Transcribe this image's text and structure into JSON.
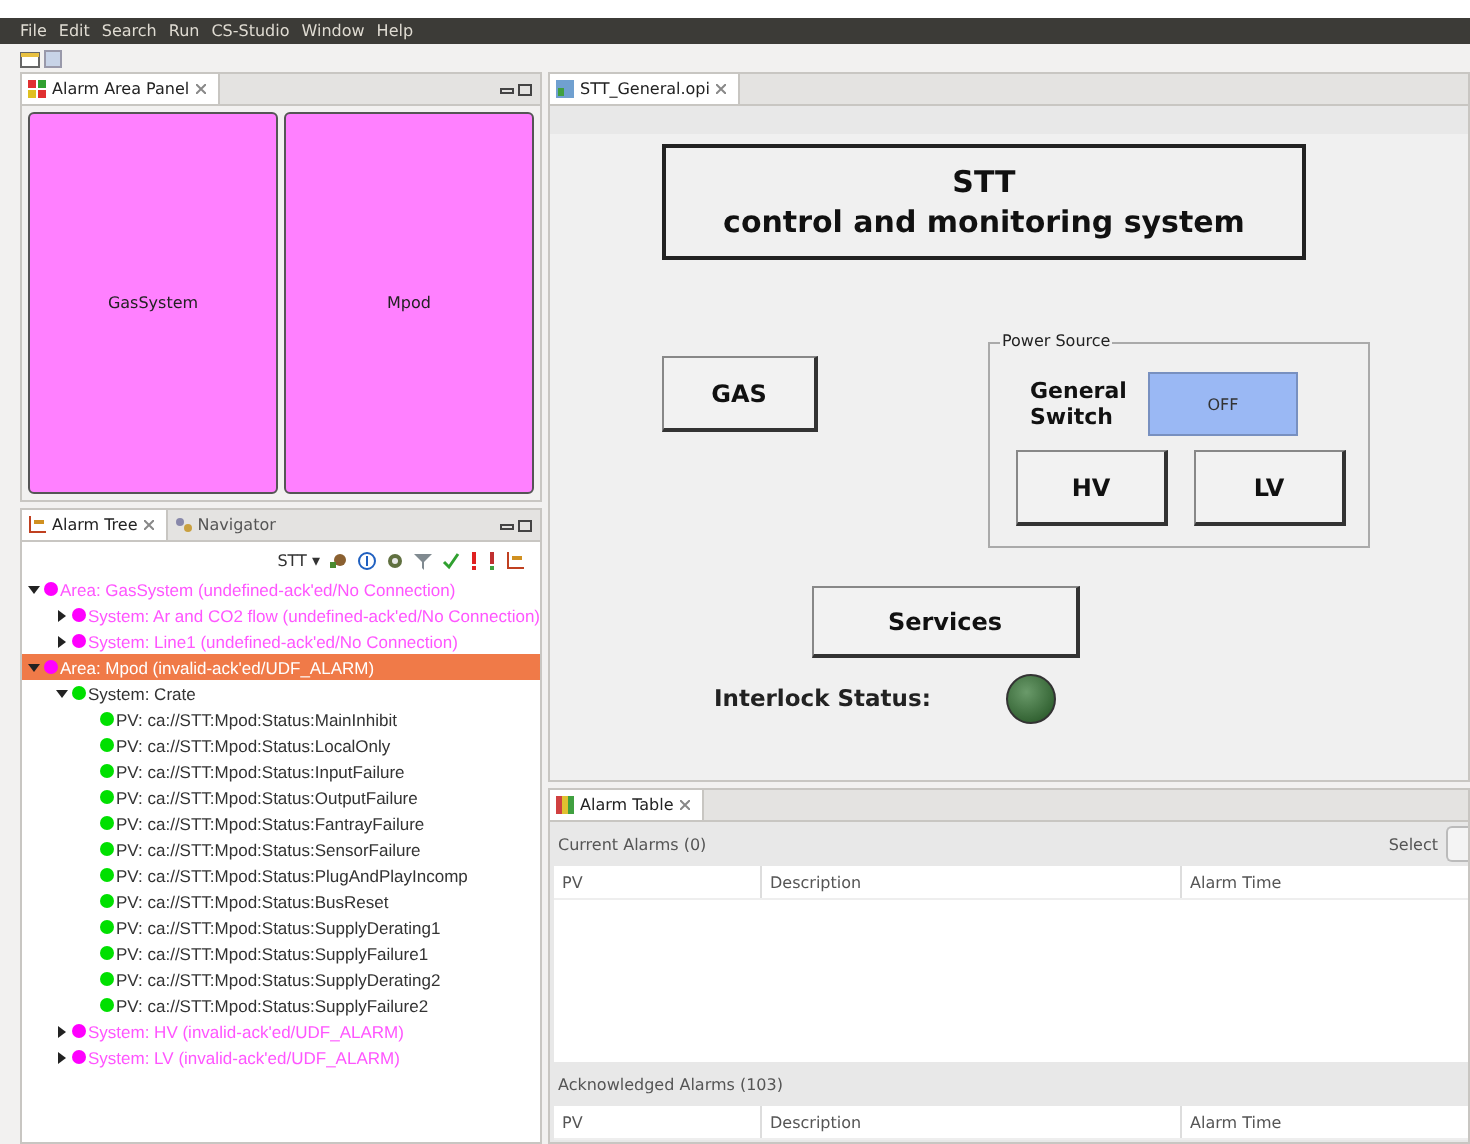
{
  "menu": [
    "File",
    "Edit",
    "Search",
    "Run",
    "CS-Studio",
    "Window",
    "Help"
  ],
  "area_panel": {
    "tab": "Alarm Area Panel",
    "areas": [
      {
        "label": "GasSystem",
        "color": "#ff80ff"
      },
      {
        "label": "Mpod",
        "color": "#ff80ff"
      }
    ]
  },
  "left_tabs": [
    {
      "label": "Alarm Tree",
      "selected": true
    },
    {
      "label": "Navigator",
      "selected": false
    }
  ],
  "tree_toolbar": {
    "config": "STT ▾"
  },
  "tree": [
    {
      "label": "Area: GasSystem (undefined-ack'ed/No Connection)",
      "alarm": true,
      "color": "#ff00ff",
      "selected": false,
      "expanded": true,
      "children": [
        {
          "label": "System: Ar and CO2 flow (undefined-ack'ed/No Connection)",
          "alarm": true,
          "color": "#ff00ff",
          "selected": false,
          "expanded": false
        },
        {
          "label": "System: Line1 (undefined-ack'ed/No Connection)",
          "alarm": true,
          "color": "#ff00ff",
          "selected": false,
          "expanded": false
        }
      ]
    },
    {
      "label": "Area: Mpod (invalid-ack'ed/UDF_ALARM)",
      "alarm": true,
      "color": "#ff00ff",
      "selected": true,
      "expanded": true,
      "children": [
        {
          "label": "System: Crate",
          "alarm": false,
          "color": "#00e000",
          "selected": false,
          "expanded": true,
          "children": [
            {
              "label": "PV: ca://STT:Mpod:Status:MainInhibit",
              "alarm": false,
              "color": "#00e000",
              "selected": false
            },
            {
              "label": "PV: ca://STT:Mpod:Status:LocalOnly",
              "alarm": false,
              "color": "#00e000",
              "selected": false
            },
            {
              "label": "PV: ca://STT:Mpod:Status:InputFailure",
              "alarm": false,
              "color": "#00e000",
              "selected": false
            },
            {
              "label": "PV: ca://STT:Mpod:Status:OutputFailure",
              "alarm": false,
              "color": "#00e000",
              "selected": false
            },
            {
              "label": "PV: ca://STT:Mpod:Status:FantrayFailure",
              "alarm": false,
              "color": "#00e000",
              "selected": false
            },
            {
              "label": "PV: ca://STT:Mpod:Status:SensorFailure",
              "alarm": false,
              "color": "#00e000",
              "selected": false
            },
            {
              "label": "PV: ca://STT:Mpod:Status:PlugAndPlayIncomp",
              "alarm": false,
              "color": "#00e000",
              "selected": false
            },
            {
              "label": "PV: ca://STT:Mpod:Status:BusReset",
              "alarm": false,
              "color": "#00e000",
              "selected": false
            },
            {
              "label": "PV: ca://STT:Mpod:Status:SupplyDerating1",
              "alarm": false,
              "color": "#00e000",
              "selected": false
            },
            {
              "label": "PV: ca://STT:Mpod:Status:SupplyFailure1",
              "alarm": false,
              "color": "#00e000",
              "selected": false
            },
            {
              "label": "PV: ca://STT:Mpod:Status:SupplyDerating2",
              "alarm": false,
              "color": "#00e000",
              "selected": false
            },
            {
              "label": "PV: ca://STT:Mpod:Status:SupplyFailure2",
              "alarm": false,
              "color": "#00e000",
              "selected": false
            }
          ]
        },
        {
          "label": "System: HV (invalid-ack'ed/UDF_ALARM)",
          "alarm": true,
          "color": "#ff00ff",
          "selected": false,
          "expanded": false
        },
        {
          "label": "System: LV (invalid-ack'ed/UDF_ALARM)",
          "alarm": true,
          "color": "#ff00ff",
          "selected": false,
          "expanded": false
        }
      ]
    }
  ],
  "editor": {
    "tab": "STT_General.opi",
    "title_line1": "STT",
    "title_line2": "control and monitoring system",
    "gas_button": "GAS",
    "power_group": "Power Source",
    "switch_label": "General Switch",
    "switch": {
      "label": "OFF",
      "on": false
    },
    "hv_button": "HV",
    "lv_button": "LV",
    "services_button": "Services",
    "interlock_label": "Interlock Status:",
    "interlock_on": false
  },
  "alarm_table": {
    "tab": "Alarm Table",
    "current": "Current Alarms (0)",
    "select": "Select",
    "columns": [
      "PV",
      "Description",
      "Alarm Time"
    ],
    "acknowledged": "Acknowledged Alarms (103)",
    "ack_columns": [
      "PV",
      "Description",
      "Alarm Time"
    ]
  }
}
